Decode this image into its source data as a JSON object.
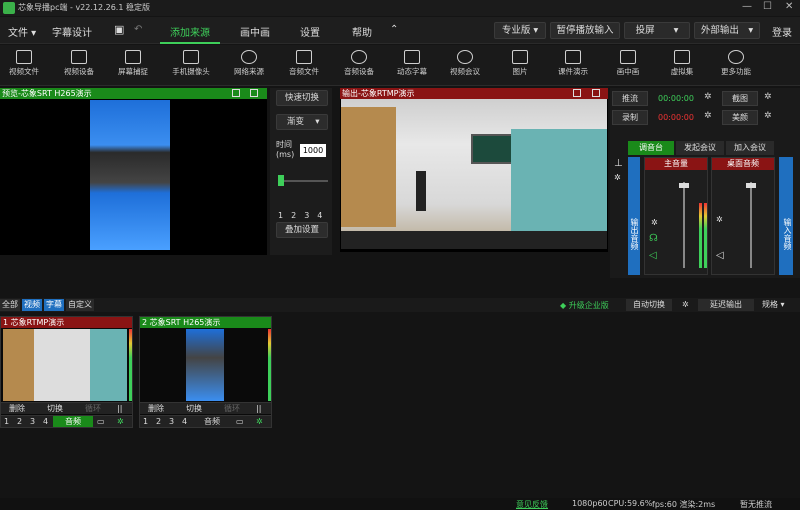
{
  "titlebar": {
    "title": "芯象导播pc端 - v22.12.26.1 稳定版",
    "min": "—",
    "max": "☐",
    "close": "✕"
  },
  "menu": {
    "file": "文件",
    "subtitle_design": "字幕设计",
    "add_source": "添加来源",
    "pip": "画中画",
    "settings": "设置",
    "help": "帮助"
  },
  "right_menu": {
    "pro": "专业版",
    "pause_input": "暂停播放输入",
    "projection": "投屏",
    "external_output": "外部输出",
    "login": "登录"
  },
  "toolbar": [
    {
      "label": "视频文件",
      "icon": "video-file-icon"
    },
    {
      "label": "视频设备",
      "icon": "video-device-icon"
    },
    {
      "label": "屏幕捕捉",
      "icon": "screen-capture-icon"
    },
    {
      "label": "手机摄像头",
      "icon": "phone-camera-icon"
    },
    {
      "label": "网络来源",
      "icon": "network-source-icon"
    },
    {
      "label": "音频文件",
      "icon": "audio-file-icon"
    },
    {
      "label": "音频设备",
      "icon": "microphone-icon"
    },
    {
      "label": "动态字幕",
      "icon": "dynamic-subtitle-icon"
    },
    {
      "label": "视频会议",
      "icon": "video-meeting-icon"
    },
    {
      "label": "图片",
      "icon": "image-icon"
    },
    {
      "label": "课件演示",
      "icon": "presentation-icon"
    },
    {
      "label": "画中画",
      "icon": "pip-icon"
    },
    {
      "label": "虚拟集",
      "icon": "virtual-set-icon"
    },
    {
      "label": "更多功能",
      "icon": "more-icon"
    }
  ],
  "preview": {
    "title": "预览-芯象SRT H265演示"
  },
  "output": {
    "title": "输出-芯象RTMP演示"
  },
  "midctl": {
    "quick_switch": "快速切换",
    "transition": "渐变",
    "time_label": "时间\n(ms)",
    "time_value": "1000",
    "pages": [
      "1",
      "2",
      "3",
      "4"
    ],
    "overlay": "叠加设置"
  },
  "stream": {
    "push": "推流",
    "push_time": "00:00:00",
    "record": "录制",
    "record_time": "00:00:00",
    "screenshot": "截图",
    "beauty": "美颜"
  },
  "mixer": {
    "tab_mixer": "调音台",
    "tab_start_meeting": "发起会议",
    "tab_join_meeting": "加入会议",
    "main_volume": "主音量",
    "desktop_audio": "桌面音频",
    "output_audio": "输出音频",
    "input_audio": "输入音频"
  },
  "sources": {
    "tabs": [
      "全部",
      "视频",
      "字幕",
      "自定义"
    ],
    "upgrade": "升级企业版",
    "auto_switch": "自动切换",
    "delay_output": "延迟输出",
    "spec": "规格",
    "cards": [
      {
        "title": "1 芯象RTMP演示",
        "delete": "删除",
        "switch": "切换",
        "loop": "循环",
        "pause": "||",
        "pages": [
          "1",
          "2",
          "3",
          "4"
        ],
        "audio": "音频",
        "audio_on": true
      },
      {
        "title": "2 芯象SRT H265演示",
        "delete": "删除",
        "switch": "切换",
        "loop": "循环",
        "pause": "||",
        "pages": [
          "1",
          "2",
          "3",
          "4"
        ],
        "audio": "音频",
        "audio_on": false
      }
    ]
  },
  "status": {
    "feedback": "意见反馈",
    "resolution": "1080p60",
    "cpu": "CPU:59.6%",
    "fps": "fps:60 渲染:2ms",
    "push_state": "暂无推流"
  },
  "colors": {
    "accent": "#3ecf5a",
    "red": "#8a1414",
    "green": "#1a8a1a",
    "blue": "#1f6fbf"
  }
}
